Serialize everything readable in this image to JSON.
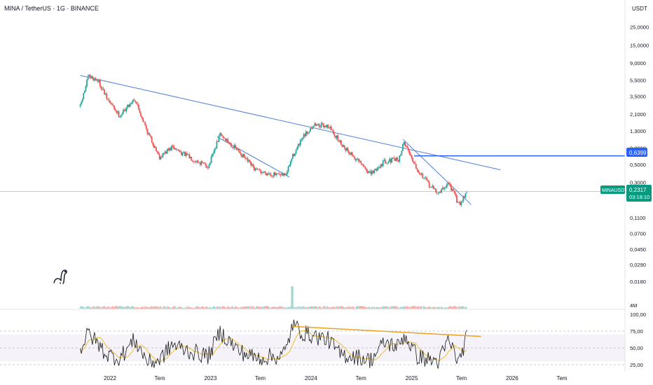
{
  "header": {
    "symbol_title": "MINA / TetherUS · 1G · BINANCE",
    "currency": "USDT"
  },
  "price_badges": {
    "symbol_tag": "MINAUSDT",
    "last_price": "0,2317",
    "countdown": "03:18:10",
    "hline_value": "0,6399"
  },
  "colors": {
    "up": "#26a69a",
    "down": "#ef5350",
    "trendline": "#4f7fd9",
    "hline": "#2962ff",
    "rsi_line": "#1a1a1a",
    "rsi_ma": "#e6c229",
    "rsi_divergence": "#f0a020",
    "rsi_band": "#7e57c2",
    "last_price": "#089981"
  },
  "chart_data": {
    "type": "candlestick",
    "scale": "log",
    "price_axis": {
      "ticks": [
        25,
        15,
        9,
        5.5,
        3.5,
        2.1,
        1.3,
        0.8,
        0.5,
        0.3,
        0.11,
        0.07,
        0.045,
        0.029,
        0.018
      ],
      "labels": [
        "25,0000",
        "15,0000",
        "9,0000",
        "5,5000",
        "3,5000",
        "2,1000",
        "1,3000",
        "0,8000",
        "0,5000",
        "0,3000",
        "0,1100",
        "0,0700",
        "0,0450",
        "0,0290",
        "0,0180"
      ]
    },
    "time_axis": {
      "labels": [
        "2022",
        "Tem",
        "2023",
        "Tem",
        "2024",
        "Tem",
        "2025",
        "Tem",
        "2026",
        "Tem"
      ],
      "dates": [
        "2022-01-01",
        "2022-07-01",
        "2023-01-01",
        "2023-07-01",
        "2024-01-01",
        "2024-07-01",
        "2025-01-01",
        "2025-07-01",
        "2026-01-01",
        "2026-07-01"
      ]
    },
    "price_anchors": [
      [
        "2021-09-15",
        2.6
      ],
      [
        "2021-10-15",
        6.2
      ],
      [
        "2021-11-20",
        5.4
      ],
      [
        "2021-12-20",
        3.3
      ],
      [
        "2022-02-05",
        2.0
      ],
      [
        "2022-03-31",
        3.3
      ],
      [
        "2022-05-20",
        1.2
      ],
      [
        "2022-06-30",
        0.62
      ],
      [
        "2022-08-15",
        0.82
      ],
      [
        "2022-10-15",
        0.62
      ],
      [
        "2022-12-25",
        0.47
      ],
      [
        "2023-02-05",
        1.18
      ],
      [
        "2023-04-15",
        0.72
      ],
      [
        "2023-06-15",
        0.42
      ],
      [
        "2023-09-15",
        0.36
      ],
      [
        "2023-10-05",
        0.39
      ],
      [
        "2023-10-25",
        0.62
      ],
      [
        "2023-12-05",
        1.1
      ],
      [
        "2024-01-10",
        1.55
      ],
      [
        "2024-03-05",
        1.5
      ],
      [
        "2024-04-15",
        0.95
      ],
      [
        "2024-06-05",
        0.62
      ],
      [
        "2024-08-05",
        0.38
      ],
      [
        "2024-09-25",
        0.55
      ],
      [
        "2024-11-15",
        0.58
      ],
      [
        "2024-12-05",
        0.95
      ],
      [
        "2025-01-20",
        0.45
      ],
      [
        "2025-03-05",
        0.28
      ],
      [
        "2025-04-10",
        0.22
      ],
      [
        "2025-05-15",
        0.3
      ],
      [
        "2025-06-22",
        0.16
      ],
      [
        "2025-07-20",
        0.2317
      ]
    ],
    "volume_axis": {
      "ticks": [
        4000000
      ],
      "labels": [
        "4M"
      ]
    },
    "volume_spike": {
      "date": "2023-10-25",
      "label": ""
    },
    "rsi": {
      "axis": {
        "ticks": [
          100,
          75,
          50,
          25
        ],
        "labels": [
          "100,00",
          "75,00",
          "50,00",
          "25,00"
        ]
      },
      "band": [
        30,
        70
      ],
      "anchors": [
        [
          "2021-09-15",
          48
        ],
        [
          "2021-10-15",
          72
        ],
        [
          "2021-11-20",
          55
        ],
        [
          "2021-12-20",
          40
        ],
        [
          "2022-02-05",
          35
        ],
        [
          "2022-03-31",
          62
        ],
        [
          "2022-05-20",
          28
        ],
        [
          "2022-06-30",
          32
        ],
        [
          "2022-08-15",
          55
        ],
        [
          "2022-10-15",
          45
        ],
        [
          "2022-12-25",
          38
        ],
        [
          "2023-02-05",
          74
        ],
        [
          "2023-04-15",
          45
        ],
        [
          "2023-06-15",
          35
        ],
        [
          "2023-09-15",
          38
        ],
        [
          "2023-10-05",
          48
        ],
        [
          "2023-10-25",
          85
        ],
        [
          "2023-12-05",
          72
        ],
        [
          "2024-01-10",
          68
        ],
        [
          "2024-03-05",
          62
        ],
        [
          "2024-04-15",
          40
        ],
        [
          "2024-06-05",
          38
        ],
        [
          "2024-08-05",
          32
        ],
        [
          "2024-09-25",
          58
        ],
        [
          "2024-11-15",
          52
        ],
        [
          "2024-12-05",
          70
        ],
        [
          "2025-01-20",
          38
        ],
        [
          "2025-03-05",
          32
        ],
        [
          "2025-04-10",
          30
        ],
        [
          "2025-05-15",
          62
        ],
        [
          "2025-06-22",
          28
        ],
        [
          "2025-07-20",
          68
        ]
      ],
      "divergence_line": [
        [
          "2023-10-25",
          82
        ],
        [
          "2025-09-10",
          67
        ]
      ]
    },
    "trendlines": [
      {
        "from": [
          "2021-09-15",
          6.3
        ],
        "to": [
          "2025-11-20",
          0.43
        ]
      },
      {
        "from": [
          "2023-01-25",
          1.1
        ],
        "to": [
          "2023-10-15",
          0.35
        ]
      },
      {
        "from": [
          "2024-12-01",
          1.02
        ],
        "to": [
          "2025-08-05",
          0.16
        ]
      }
    ],
    "horizontal_line": {
      "from": "2025-01-10",
      "price": 0.6399
    },
    "grid": false
  }
}
